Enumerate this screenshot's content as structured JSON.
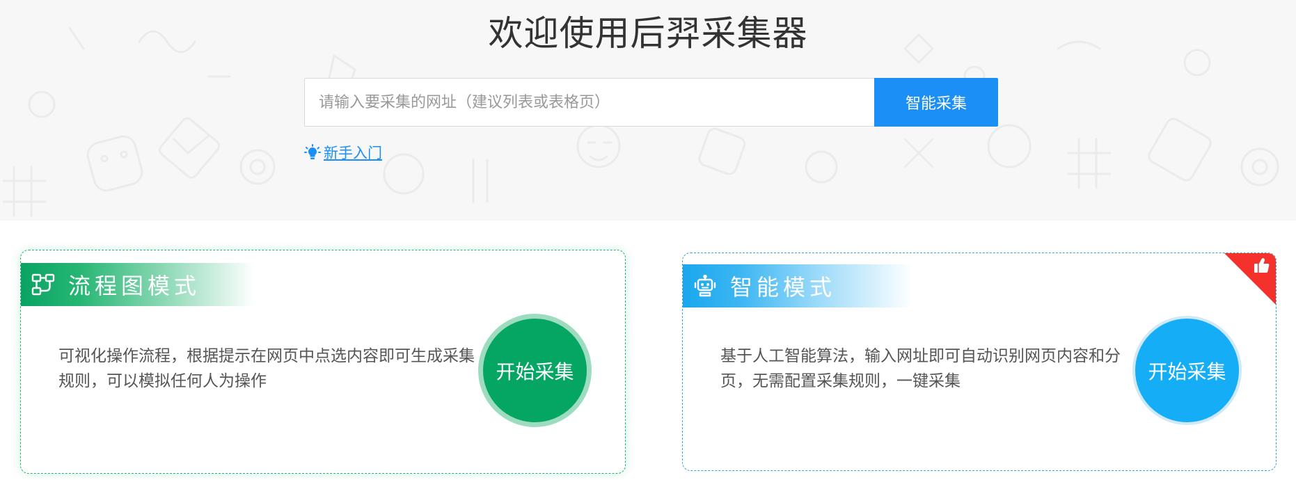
{
  "hero": {
    "title": "欢迎使用后羿采集器",
    "search": {
      "placeholder": "请输入要采集的网址（建议列表或表格页）",
      "value": "",
      "button_label": "智能采集"
    },
    "guide": {
      "label": "新手入门",
      "icon": "lightbulb-icon"
    }
  },
  "modes": {
    "flow": {
      "title": "流程图模式",
      "icon": "flowchart-icon",
      "description": "可视化操作流程，根据提示在网页中点选内容即可生成采集规则，可以模拟任何人为操作",
      "button_label": "开始采集",
      "accent": "#05a564"
    },
    "smart": {
      "title": "智能模式",
      "icon": "robot-icon",
      "description": "基于人工智能算法，输入网址即可自动识别网页内容和分页，无需配置采集规则，一键采集",
      "button_label": "开始采集",
      "accent": "#14adf6",
      "badge_icon": "thumbs-up-icon",
      "badge_color": "#f5312c"
    }
  }
}
